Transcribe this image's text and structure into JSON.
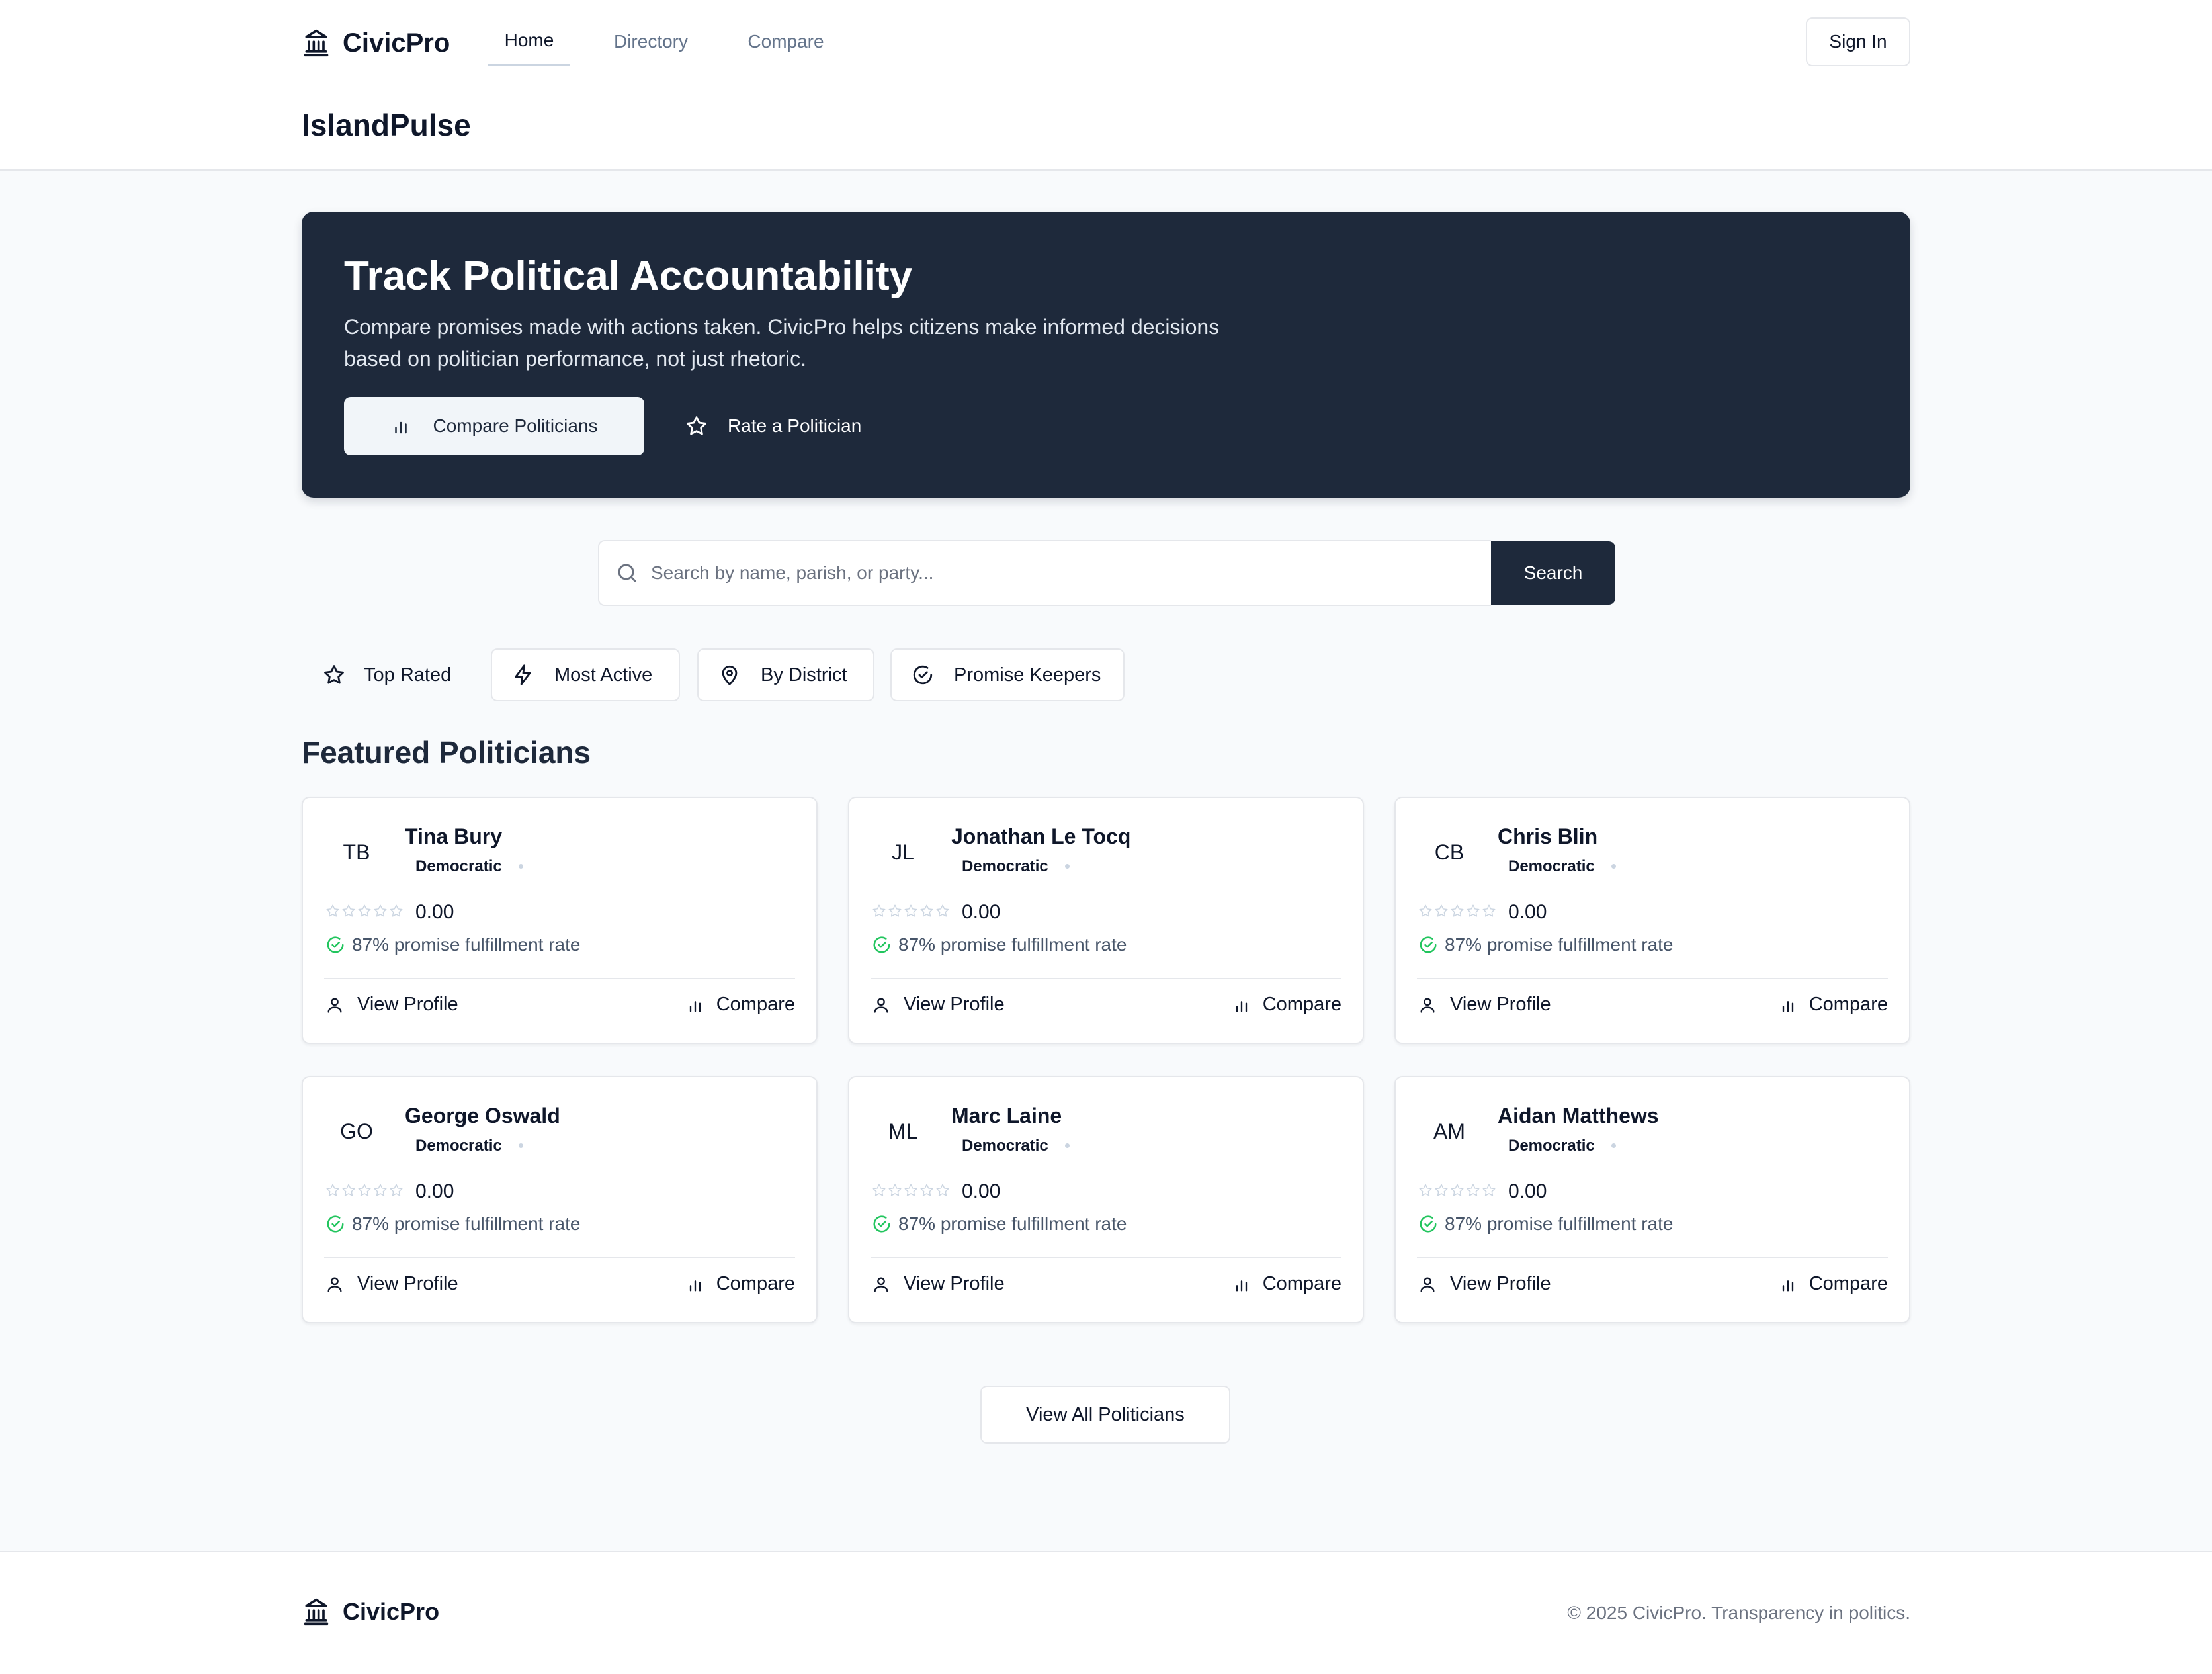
{
  "app": {
    "name": "CivicPro",
    "site_title": "IslandPulse"
  },
  "nav": {
    "items": [
      {
        "label": "Home",
        "active": true
      },
      {
        "label": "Directory",
        "active": false
      },
      {
        "label": "Compare",
        "active": false
      }
    ],
    "sign_in": "Sign In"
  },
  "hero": {
    "title": "Track Political Accountability",
    "description": "Compare promises made with actions taken. CivicPro helps citizens make informed decisions based on politician performance, not just rhetoric.",
    "primary_button": "Compare Politicians",
    "secondary_button": "Rate a Politician"
  },
  "search": {
    "placeholder": "Search by name, parish, or party...",
    "value": "",
    "button": "Search"
  },
  "filters": [
    {
      "label": "Top Rated",
      "icon": "star-icon"
    },
    {
      "label": "Most Active",
      "icon": "lightning-icon"
    },
    {
      "label": "By District",
      "icon": "map-pin-icon"
    },
    {
      "label": "Promise Keepers",
      "icon": "check-circle-icon"
    }
  ],
  "featured": {
    "title": "Featured Politicians",
    "politicians": [
      {
        "initials": "TB",
        "name": "Tina Bury",
        "party": "Democratic",
        "rating": "0.00",
        "fulfillment": "87% promise fulfillment rate",
        "view_label": "View Profile",
        "compare_label": "Compare"
      },
      {
        "initials": "JL",
        "name": "Jonathan Le Tocq",
        "party": "Democratic",
        "rating": "0.00",
        "fulfillment": "87% promise fulfillment rate",
        "view_label": "View Profile",
        "compare_label": "Compare"
      },
      {
        "initials": "CB",
        "name": "Chris Blin",
        "party": "Democratic",
        "rating": "0.00",
        "fulfillment": "87% promise fulfillment rate",
        "view_label": "View Profile",
        "compare_label": "Compare"
      },
      {
        "initials": "GO",
        "name": "George Oswald",
        "party": "Democratic",
        "rating": "0.00",
        "fulfillment": "87% promise fulfillment rate",
        "view_label": "View Profile",
        "compare_label": "Compare"
      },
      {
        "initials": "ML",
        "name": "Marc Laine",
        "party": "Democratic",
        "rating": "0.00",
        "fulfillment": "87% promise fulfillment rate",
        "view_label": "View Profile",
        "compare_label": "Compare"
      },
      {
        "initials": "AM",
        "name": "Aidan Matthews",
        "party": "Democratic",
        "rating": "0.00",
        "fulfillment": "87% promise fulfillment rate",
        "view_label": "View Profile",
        "compare_label": "Compare"
      }
    ],
    "view_all": "View All Politicians"
  },
  "footer": {
    "name": "CivicPro",
    "copyright": "© 2025 CivicPro. Transparency in politics."
  },
  "colors": {
    "dark": "#1e293b",
    "border": "#e5e7eb",
    "success": "#22c55e",
    "muted": "#64748b"
  }
}
